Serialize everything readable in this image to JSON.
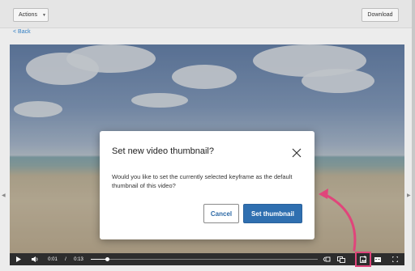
{
  "toolbar": {
    "actions_label": "Actions",
    "actions_caret": "▼",
    "download_label": "Download"
  },
  "nav": {
    "back_label": "< Back"
  },
  "player": {
    "current_time": "0:01",
    "separator": "/",
    "duration": "0:13",
    "progress_fraction": 0.07
  },
  "dialog": {
    "title": "Set new video thumbnail?",
    "body": "Would you like to set the currently selected keyframe as the default thumbnail of this video?",
    "cancel_label": "Cancel",
    "confirm_label": "Set thumbnail"
  },
  "colors": {
    "accent": "#2f6fb0",
    "link": "#2f7dc3",
    "annotation": "#e0457b"
  },
  "icons": [
    "play-icon",
    "volume-icon",
    "clip-icon",
    "copy-icon",
    "set-thumbnail-icon",
    "captions-icon",
    "fullscreen-icon",
    "close-icon"
  ]
}
